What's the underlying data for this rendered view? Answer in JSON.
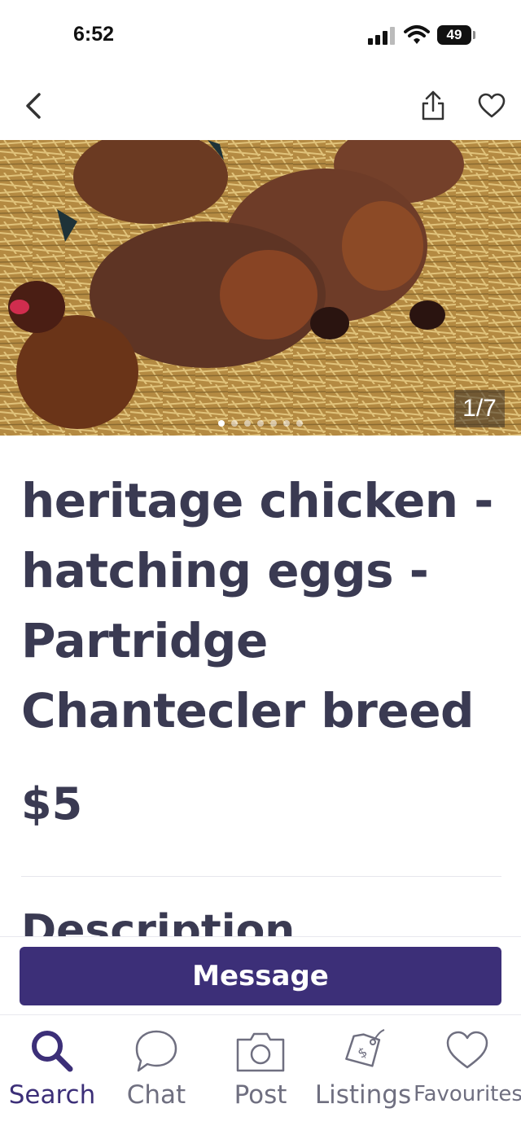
{
  "status_bar": {
    "time": "6:52",
    "battery": "49"
  },
  "listing": {
    "photo_counter": "1/7",
    "photo_count": 7,
    "photo_current": 1,
    "title_lines": [
      "heritage chicken -",
      "hatching eggs -",
      "Partridge",
      "Chantecler breed"
    ],
    "price": "$5",
    "description_heading": "Description"
  },
  "actions": {
    "message_label": "Message"
  },
  "tabs": [
    {
      "label": "Search",
      "icon": "search-icon",
      "active": true
    },
    {
      "label": "Chat",
      "icon": "chat-bubble-icon",
      "active": false
    },
    {
      "label": "Post",
      "icon": "camera-icon",
      "active": false
    },
    {
      "label": "Listings",
      "icon": "price-tag-icon",
      "active": false
    },
    {
      "label": "Favourites",
      "icon": "heart-icon",
      "active": false
    }
  ],
  "colors": {
    "brand": "#3c2f78",
    "text": "#3a3a52",
    "tab_inactive": "#6f6f80"
  }
}
